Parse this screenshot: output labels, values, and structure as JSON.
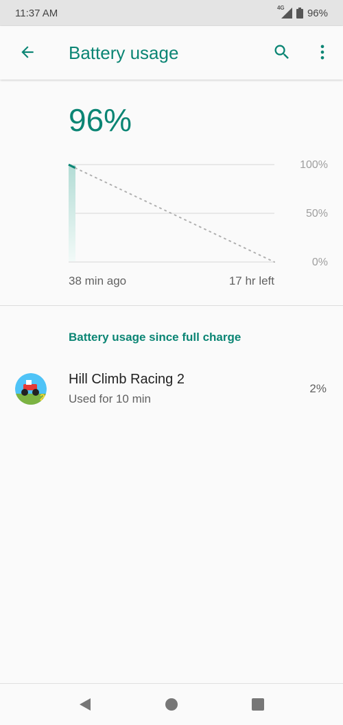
{
  "status_bar": {
    "time": "11:37 AM",
    "network": "4G",
    "battery_pct": "96%"
  },
  "app_bar": {
    "title": "Battery usage",
    "icons": [
      "back-arrow-icon",
      "search-icon",
      "more-vert-icon"
    ]
  },
  "battery": {
    "level": "96%",
    "chart": {
      "y_labels": [
        "100%",
        "50%",
        "0%"
      ],
      "x_left": "38 min ago",
      "x_right": "17 hr left"
    }
  },
  "usage": {
    "section_title": "Battery usage since full charge",
    "items": [
      {
        "name": "Hill Climb Racing 2",
        "detail": "Used for 10 min",
        "percent": "2%"
      }
    ]
  },
  "colors": {
    "accent": "#0b8574",
    "background": "#fafafa"
  }
}
